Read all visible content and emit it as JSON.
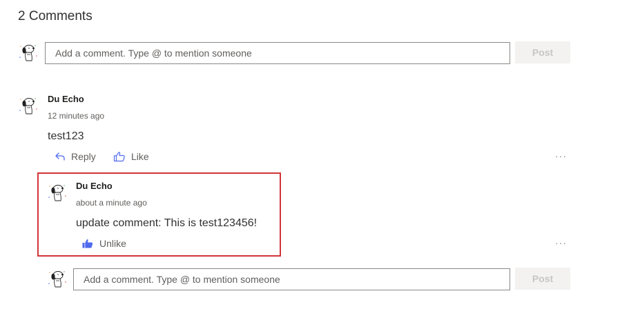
{
  "header": {
    "title": "2 Comments"
  },
  "new_comment": {
    "placeholder": "Add a comment. Type @ to mention someone",
    "post_label": "Post"
  },
  "comment": {
    "author": "Du Echo",
    "time": "12 minutes ago",
    "text": "test123",
    "reply_label": "Reply",
    "like_label": "Like",
    "more_label": "···"
  },
  "reply": {
    "author": "Du Echo",
    "time": "about a minute ago",
    "text": "update comment: This is test123456!",
    "unlike_label": "Unlike",
    "more_label": "···"
  },
  "reply_input": {
    "placeholder": "Add a comment. Type @ to mention someone",
    "post_label": "Post"
  },
  "colors": {
    "accent": "#4f6bed",
    "highlight": "#d13438",
    "disabled_bg": "#f3f2f1",
    "disabled_text": "#c8c6c4"
  },
  "icons": {
    "avatar": "snoopy-avatar",
    "reply": "reply-arrow-icon",
    "like": "thumbs-up-outline-icon",
    "unlike": "thumbs-up-filled-icon",
    "more": "more-dots-icon"
  }
}
